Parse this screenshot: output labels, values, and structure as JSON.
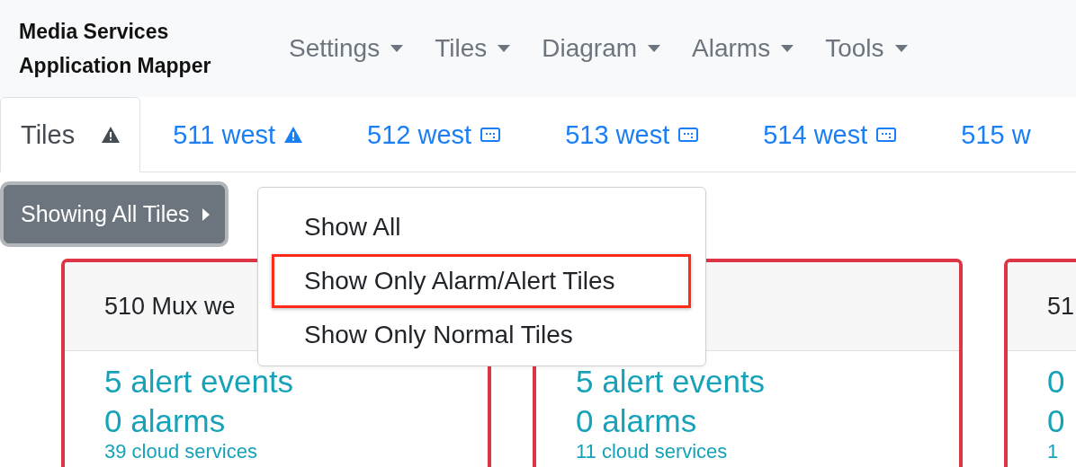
{
  "navbar": {
    "brand": [
      "Media Services",
      "Application Mapper"
    ],
    "menus": [
      {
        "label": "Settings"
      },
      {
        "label": "Tiles"
      },
      {
        "label": "Diagram"
      },
      {
        "label": "Alarms"
      },
      {
        "label": "Tools"
      }
    ]
  },
  "tabs": [
    {
      "label": "Tiles",
      "kind": "alert",
      "selected": true
    },
    {
      "label": "511 west",
      "kind": "alert",
      "selected": false
    },
    {
      "label": "512 west",
      "kind": "normal",
      "selected": false
    },
    {
      "label": "513 west",
      "kind": "normal",
      "selected": false
    },
    {
      "label": "514 west",
      "kind": "normal",
      "selected": false
    },
    {
      "label": "515 w",
      "selected": false
    }
  ],
  "filter_button": {
    "label": "Showing All Tiles",
    "expanded": true
  },
  "filter_menu": [
    {
      "label": "Show All",
      "highlighted": false
    },
    {
      "label": "Show Only Alarm/Alert Tiles",
      "highlighted": true
    },
    {
      "label": "Show Only Normal Tiles",
      "highlighted": false
    }
  ],
  "tiles": [
    {
      "title": "510 Mux we",
      "kind": "alert",
      "events": "5 alert events",
      "alarms": "0 alarms",
      "services": "39 cloud services"
    },
    {
      "kind": "alert",
      "events": "5 alert events",
      "alarms": "0 alarms",
      "services": "11 cloud services"
    },
    {
      "title": "51",
      "kind": "alert",
      "events": "0",
      "alarms": "0",
      "services": "1"
    }
  ]
}
